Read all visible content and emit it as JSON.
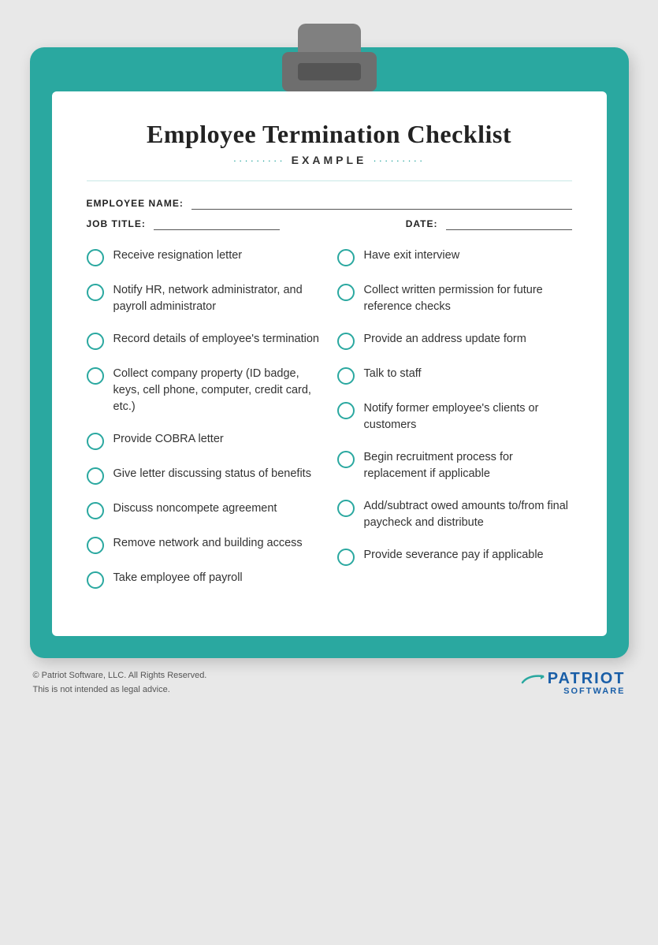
{
  "title": "Employee Termination Checklist",
  "subtitle": "EXAMPLE",
  "subtitle_dots": "·········",
  "form": {
    "employee_name_label": "EMPLOYEE NAME:",
    "job_title_label": "JOB TITLE:",
    "date_label": "DATE:"
  },
  "left_column": [
    "Receive resignation letter",
    "Notify HR, network administrator, and payroll administrator",
    "Record details of employee's termination",
    "Collect company property (ID badge, keys, cell phone, computer, credit card, etc.)",
    "Provide COBRA letter",
    "Give letter discussing status of benefits",
    "Discuss noncompete agreement",
    "Remove network and building access",
    "Take employee off payroll"
  ],
  "right_column": [
    "Have exit interview",
    "Collect written permission for future reference checks",
    "Provide an address update form",
    "Talk to staff",
    "Notify former employee's clients or customers",
    "Begin recruitment process for replacement if applicable",
    "Add/subtract owed amounts to/from final paycheck and distribute",
    "Provide severance pay if applicable"
  ],
  "footer": {
    "copyright": "© Patriot Software, LLC. All Rights Reserved.",
    "disclaimer": "This is not intended as legal advice.",
    "brand_name": "PATRIOT",
    "brand_sub": "SOFTWARE"
  }
}
